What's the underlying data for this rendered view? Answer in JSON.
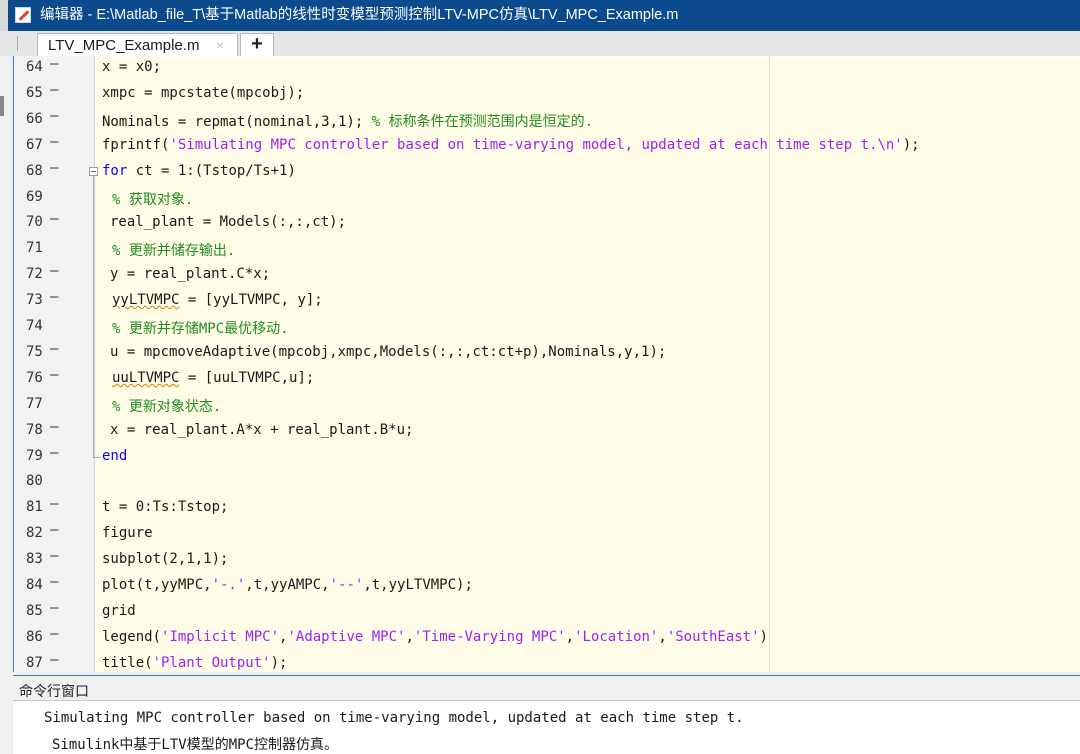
{
  "window": {
    "title": "编辑器 - E:\\Matlab_file_T\\基于Matlab的线性时变模型预测控制LTV-MPC仿真\\LTV_MPC_Example.m"
  },
  "tabs": {
    "active_label": "LTV_MPC_Example.m",
    "close_glyph": "×",
    "add_glyph": "+"
  },
  "editor": {
    "lines": [
      {
        "n": "64",
        "dash": "—",
        "parts": [
          {
            "t": "x = x0;",
            "c": ""
          }
        ]
      },
      {
        "n": "65",
        "dash": "—",
        "parts": [
          {
            "t": "xmpc = mpcstate(mpcobj);",
            "c": ""
          }
        ]
      },
      {
        "n": "66",
        "dash": "—",
        "parts": [
          {
            "t": "Nominals = repmat(nominal,3,1); ",
            "c": ""
          },
          {
            "t": "% 标称条件在预测范围内是恒定的.",
            "c": "cm"
          }
        ]
      },
      {
        "n": "67",
        "dash": "—",
        "parts": [
          {
            "t": "fprintf(",
            "c": ""
          },
          {
            "t": "'Simulating MPC controller based on time-varying model, updated at each time step t.\\n'",
            "c": "str"
          },
          {
            "t": ");",
            "c": ""
          }
        ]
      },
      {
        "n": "68",
        "dash": "—",
        "parts": [
          {
            "t": "for",
            "c": "kw"
          },
          {
            "t": " ct = 1:(Tstop/Ts+1)",
            "c": ""
          }
        ]
      },
      {
        "n": "69",
        "dash": "",
        "parts": [
          {
            "t": "% 获取对象.",
            "c": "cm"
          }
        ]
      },
      {
        "n": "70",
        "dash": "—",
        "parts": [
          {
            "t": "real_plant = Models(:,:,ct);",
            "c": ""
          }
        ]
      },
      {
        "n": "71",
        "dash": "",
        "parts": [
          {
            "t": "% 更新并储存输出.",
            "c": "cm"
          }
        ]
      },
      {
        "n": "72",
        "dash": "—",
        "parts": [
          {
            "t": "y = real_plant.C*x;",
            "c": ""
          }
        ]
      },
      {
        "n": "73",
        "dash": "—",
        "parts": [
          {
            "t": "yyLTVMPC",
            "c": "squig"
          },
          {
            "t": " = [yyLTVMPC, y];",
            "c": ""
          }
        ]
      },
      {
        "n": "74",
        "dash": "",
        "parts": [
          {
            "t": "% 更新并存储MPC最优移动.",
            "c": "cm"
          }
        ]
      },
      {
        "n": "75",
        "dash": "—",
        "parts": [
          {
            "t": "u = mpcmoveAdaptive(mpcobj,xmpc,Models(:,:,ct:ct+p),Nominals,y,1);",
            "c": ""
          }
        ]
      },
      {
        "n": "76",
        "dash": "—",
        "parts": [
          {
            "t": "uuLTVMPC",
            "c": "squig"
          },
          {
            "t": " = [uuLTVMPC,u];",
            "c": ""
          }
        ]
      },
      {
        "n": "77",
        "dash": "",
        "parts": [
          {
            "t": "% 更新对象状态.",
            "c": "cm"
          }
        ]
      },
      {
        "n": "78",
        "dash": "—",
        "parts": [
          {
            "t": "x = real_plant.A*x + real_plant.B*u;",
            "c": ""
          }
        ]
      },
      {
        "n": "79",
        "dash": "—",
        "parts": [
          {
            "t": "end",
            "c": "kw"
          }
        ]
      },
      {
        "n": "80",
        "dash": "",
        "parts": []
      },
      {
        "n": "81",
        "dash": "—",
        "parts": [
          {
            "t": "t = 0:Ts:Tstop;",
            "c": ""
          }
        ]
      },
      {
        "n": "82",
        "dash": "—",
        "parts": [
          {
            "t": "figure",
            "c": ""
          }
        ]
      },
      {
        "n": "83",
        "dash": "—",
        "parts": [
          {
            "t": "subplot(2,1,1);",
            "c": ""
          }
        ]
      },
      {
        "n": "84",
        "dash": "—",
        "parts": [
          {
            "t": "plot(t,yyMPC,",
            "c": ""
          },
          {
            "t": "'-.'",
            "c": "str"
          },
          {
            "t": ",t,yyAMPC,",
            "c": ""
          },
          {
            "t": "'--'",
            "c": "str"
          },
          {
            "t": ",t,yyLTVMPC);",
            "c": ""
          }
        ]
      },
      {
        "n": "85",
        "dash": "—",
        "parts": [
          {
            "t": "grid",
            "c": ""
          }
        ]
      },
      {
        "n": "86",
        "dash": "—",
        "parts": [
          {
            "t": "legend(",
            "c": ""
          },
          {
            "t": "'Implicit MPC'",
            "c": "str"
          },
          {
            "t": ",",
            "c": ""
          },
          {
            "t": "'Adaptive MPC'",
            "c": "str"
          },
          {
            "t": ",",
            "c": ""
          },
          {
            "t": "'Time-Varying MPC'",
            "c": "str"
          },
          {
            "t": ",",
            "c": ""
          },
          {
            "t": "'Location'",
            "c": "str"
          },
          {
            "t": ",",
            "c": ""
          },
          {
            "t": "'SouthEast'",
            "c": "str"
          },
          {
            "t": ")",
            "c": ""
          }
        ]
      },
      {
        "n": "87",
        "dash": "—",
        "parts": [
          {
            "t": "title(",
            "c": ""
          },
          {
            "t": "'Plant Output'",
            "c": "str"
          },
          {
            "t": ");",
            "c": ""
          }
        ]
      }
    ]
  },
  "command_window": {
    "title": "命令行窗口",
    "line1": "Simulating MPC controller based on time-varying model, updated at each time step t.",
    "line2": "Simulink中基于LTV模型的MPC控制器仿真。"
  },
  "colors": {
    "keyword": "#0e00ff",
    "string": "#a020f0",
    "comment": "#228b22",
    "editor_bg": "#fffde8",
    "titlebar_bg": "#0b4a8c"
  }
}
